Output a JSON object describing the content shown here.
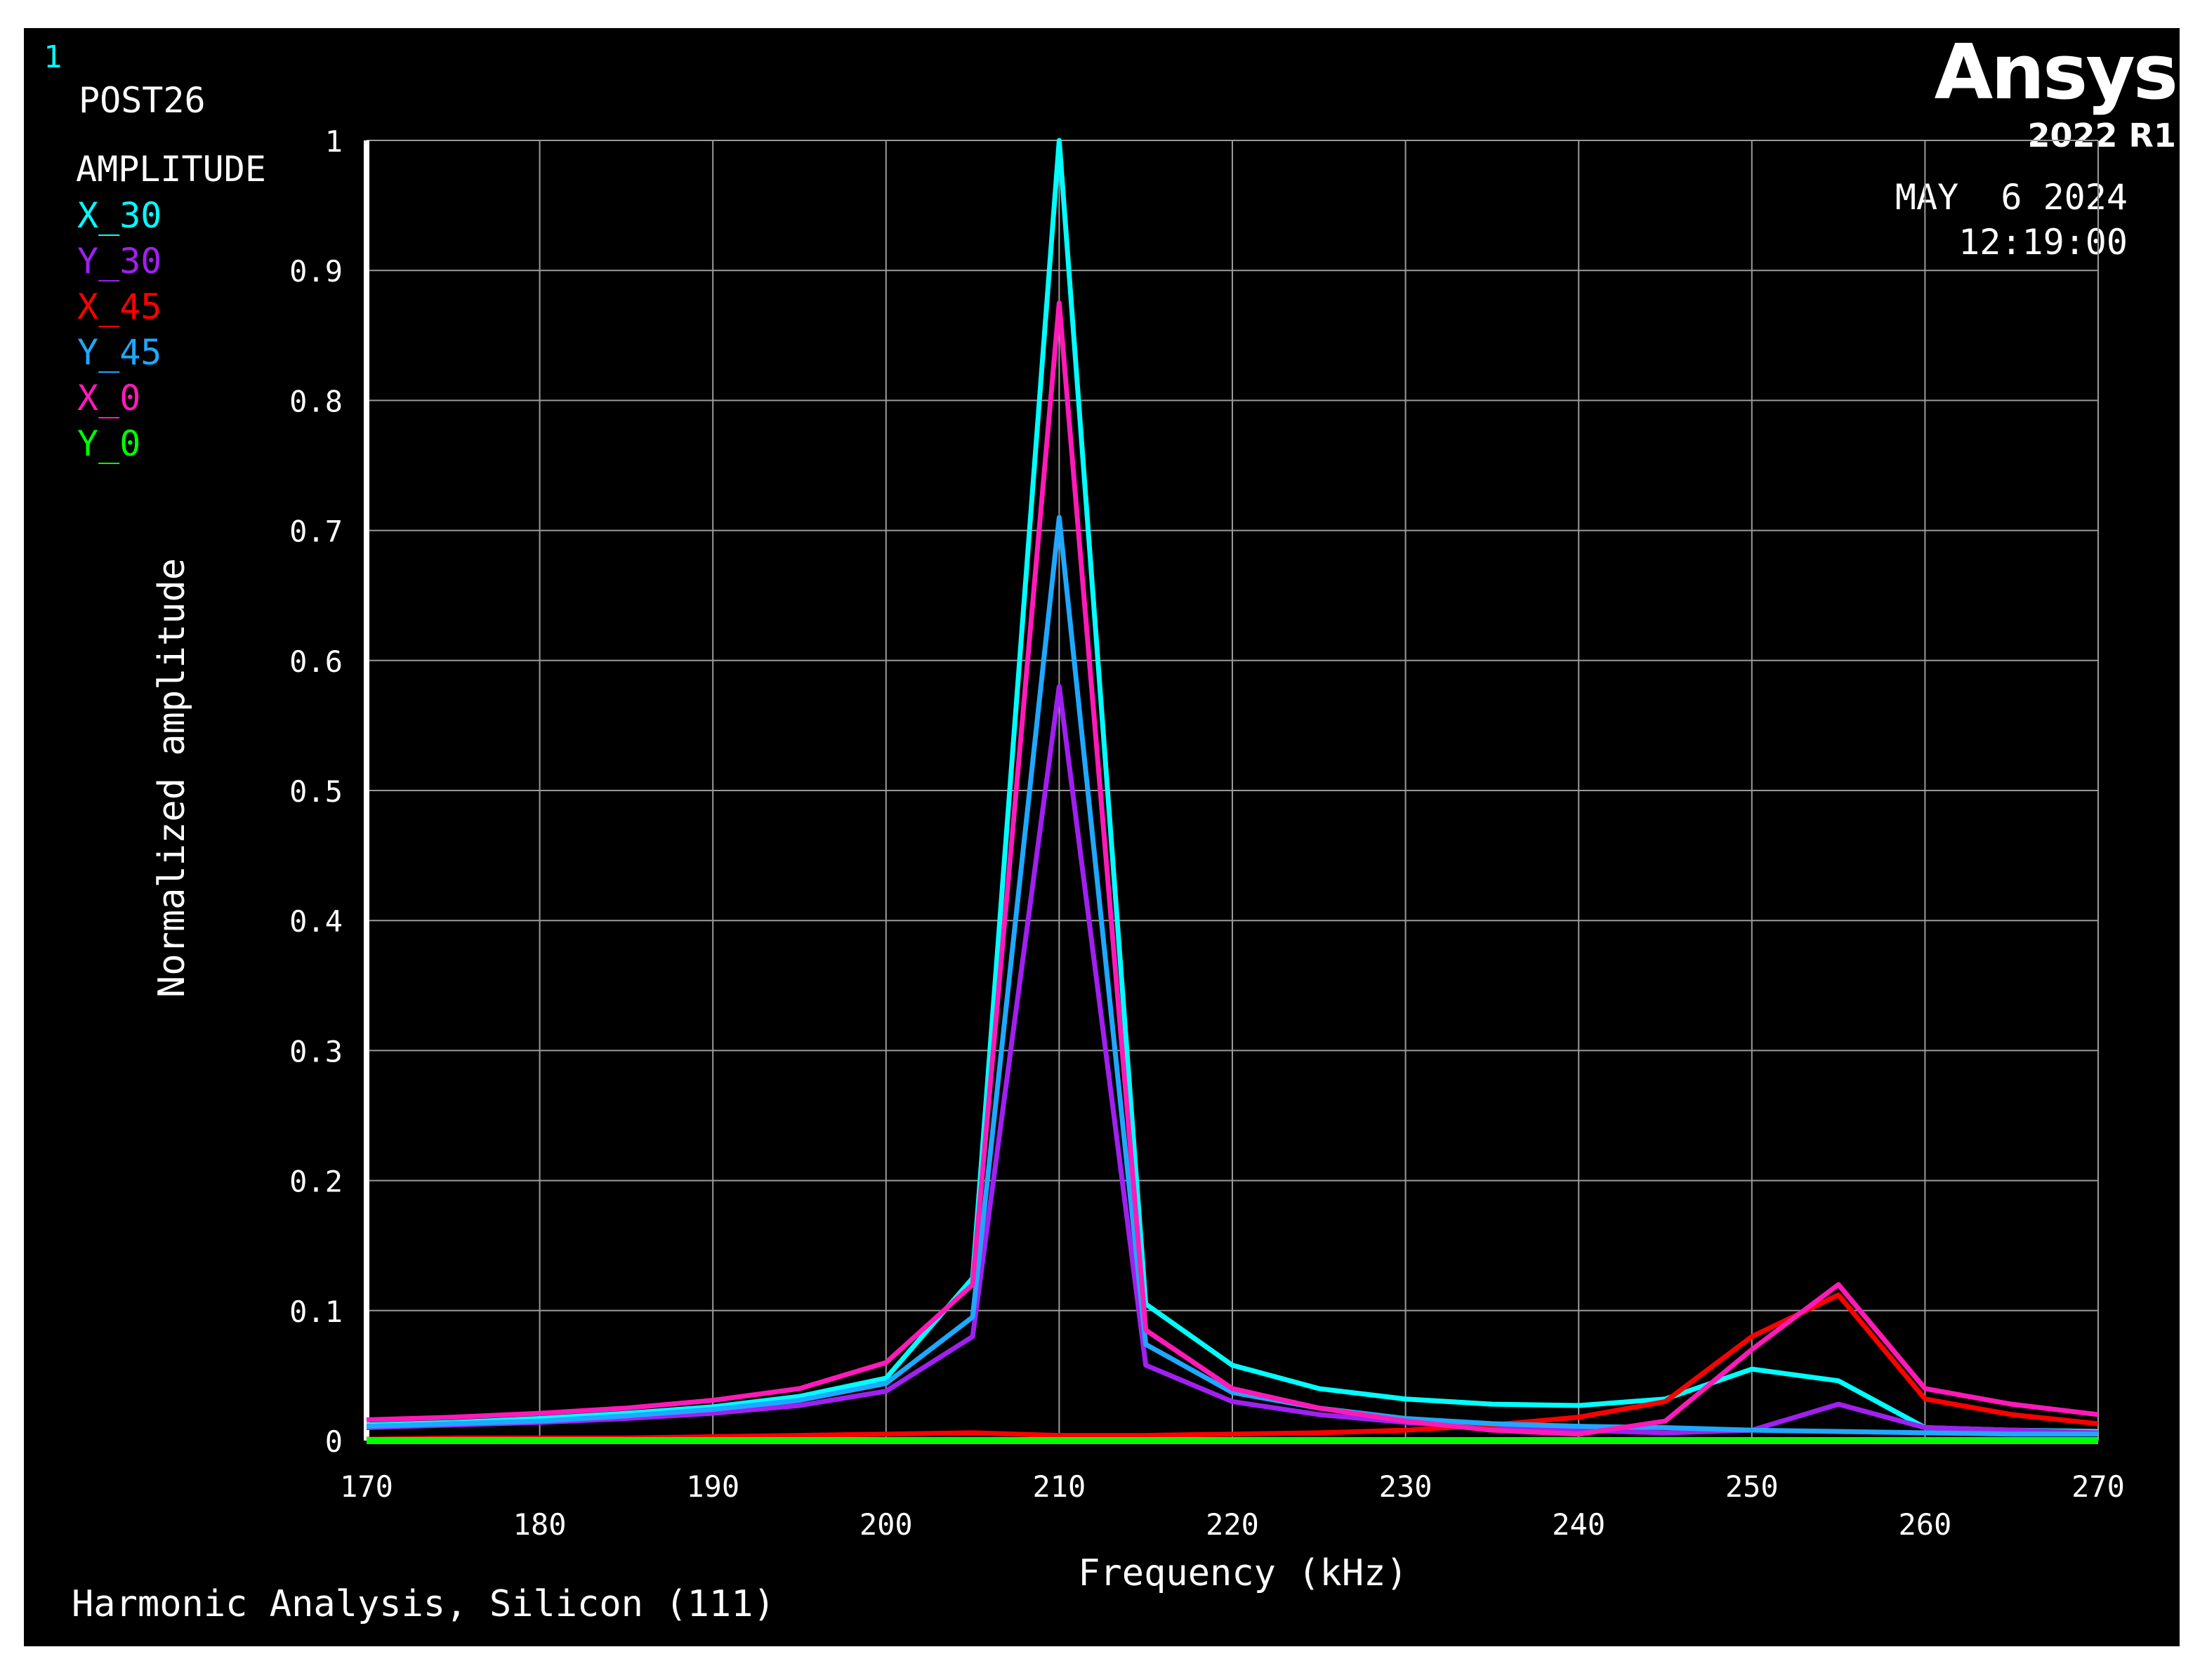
{
  "window_number": "1",
  "program": "POST26",
  "variable_label": "AMPLITUDE",
  "brand": {
    "name": "Ansys",
    "version": "2022 R1"
  },
  "date": "MAY  6 2024",
  "time": "12:19:00",
  "footer": "Harmonic Analysis, Silicon (111)",
  "chart_data": {
    "type": "line",
    "xlabel": "Frequency (kHz)",
    "ylabel": "Normalized amplitude",
    "xlim": [
      170,
      270
    ],
    "ylim": [
      0,
      1
    ],
    "x_ticks": [
      170,
      180,
      190,
      200,
      210,
      220,
      230,
      240,
      250,
      260,
      270
    ],
    "y_ticks": [
      "0",
      "0.1",
      "0.2",
      "0.3",
      "0.4",
      "0.5",
      "0.6",
      "0.7",
      "0.8",
      "0.9",
      "1"
    ],
    "grid": true,
    "legend_placement": "top-left",
    "x": [
      170,
      175,
      180,
      185,
      190,
      195,
      200,
      205,
      210,
      215,
      220,
      225,
      230,
      235,
      240,
      245,
      250,
      255,
      260,
      265,
      270
    ],
    "series": [
      {
        "name": "X_30",
        "color": "#00ffff",
        "values": [
          0.012,
          0.014,
          0.017,
          0.021,
          0.026,
          0.034,
          0.048,
          0.125,
          1.0,
          0.105,
          0.058,
          0.04,
          0.032,
          0.028,
          0.027,
          0.032,
          0.055,
          0.046,
          0.01,
          0.008,
          0.007
        ]
      },
      {
        "name": "Y_30",
        "color": "#a020f0",
        "values": [
          0.01,
          0.012,
          0.014,
          0.017,
          0.021,
          0.027,
          0.038,
          0.08,
          0.58,
          0.058,
          0.03,
          0.02,
          0.014,
          0.01,
          0.008,
          0.006,
          0.008,
          0.028,
          0.01,
          0.008,
          0.006
        ]
      },
      {
        "name": "X_45",
        "color": "#ff0000",
        "values": [
          0.001,
          0.002,
          0.002,
          0.002,
          0.003,
          0.004,
          0.005,
          0.006,
          0.004,
          0.004,
          0.005,
          0.006,
          0.008,
          0.012,
          0.018,
          0.03,
          0.08,
          0.112,
          0.032,
          0.02,
          0.013
        ]
      },
      {
        "name": "Y_45",
        "color": "#1fa8ff",
        "values": [
          0.011,
          0.013,
          0.015,
          0.019,
          0.024,
          0.031,
          0.044,
          0.095,
          0.71,
          0.074,
          0.037,
          0.025,
          0.017,
          0.013,
          0.011,
          0.01,
          0.008,
          0.007,
          0.006,
          0.005,
          0.005
        ]
      },
      {
        "name": "X_0",
        "color": "#ff1ab8",
        "values": [
          0.016,
          0.018,
          0.021,
          0.025,
          0.031,
          0.04,
          0.06,
          0.12,
          0.875,
          0.085,
          0.04,
          0.025,
          0.015,
          0.008,
          0.005,
          0.015,
          0.07,
          0.12,
          0.04,
          0.028,
          0.02
        ]
      },
      {
        "name": "Y_0",
        "color": "#00ff00",
        "values": [
          0.0,
          0.0,
          0.0,
          0.0,
          0.0,
          0.0,
          0.0,
          0.0,
          0.0,
          0.0,
          0.0,
          0.0,
          0.0,
          0.0,
          0.0,
          0.0,
          0.0,
          0.0,
          0.0,
          0.0,
          0.0
        ]
      }
    ]
  }
}
